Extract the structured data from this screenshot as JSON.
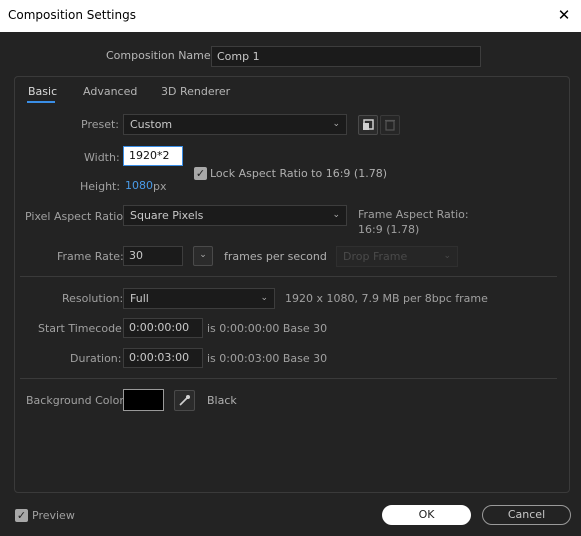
{
  "window": {
    "title": "Composition Settings",
    "close_glyph": "✕"
  },
  "comp_name": {
    "label": "Composition Name:",
    "value": "Comp 1"
  },
  "tabs": [
    {
      "label": "Basic",
      "active": true
    },
    {
      "label": "Advanced",
      "active": false
    },
    {
      "label": "3D Renderer",
      "active": false
    }
  ],
  "preset": {
    "label": "Preset:",
    "value": "Custom"
  },
  "width": {
    "label": "Width:",
    "value": "1920*2"
  },
  "height": {
    "label": "Height:",
    "value": "1080",
    "unit": "px"
  },
  "lock_aspect": {
    "label": "Lock Aspect Ratio to 16:9 (1.78)",
    "checked": true
  },
  "pixel_aspect": {
    "label": "Pixel Aspect Ratio:",
    "value": "Square Pixels"
  },
  "frame_aspect": {
    "label": "Frame Aspect Ratio:",
    "value": "16:9 (1.78)"
  },
  "frame_rate": {
    "label": "Frame Rate:",
    "value": "30",
    "unit": "frames per second",
    "drop_frame": "Drop Frame"
  },
  "resolution": {
    "label": "Resolution:",
    "value": "Full",
    "info": "1920 x 1080, 7.9 MB per 8bpc frame"
  },
  "start_timecode": {
    "label": "Start Timecode:",
    "value": "0:00:00:00",
    "info": "is 0:00:00:00  Base 30"
  },
  "duration": {
    "label": "Duration:",
    "value": "0:00:03:00",
    "info": "is 0:00:03:00  Base 30"
  },
  "background": {
    "label": "Background Color:",
    "color_name": "Black",
    "swatch": "#000000"
  },
  "preview": {
    "label": "Preview",
    "checked": true
  },
  "buttons": {
    "ok": "OK",
    "cancel": "Cancel"
  },
  "colors": {
    "accent": "#3a8ee6",
    "panel_bg": "#232323"
  },
  "glyphs": {
    "chevron": "⌄",
    "check": "✓"
  }
}
